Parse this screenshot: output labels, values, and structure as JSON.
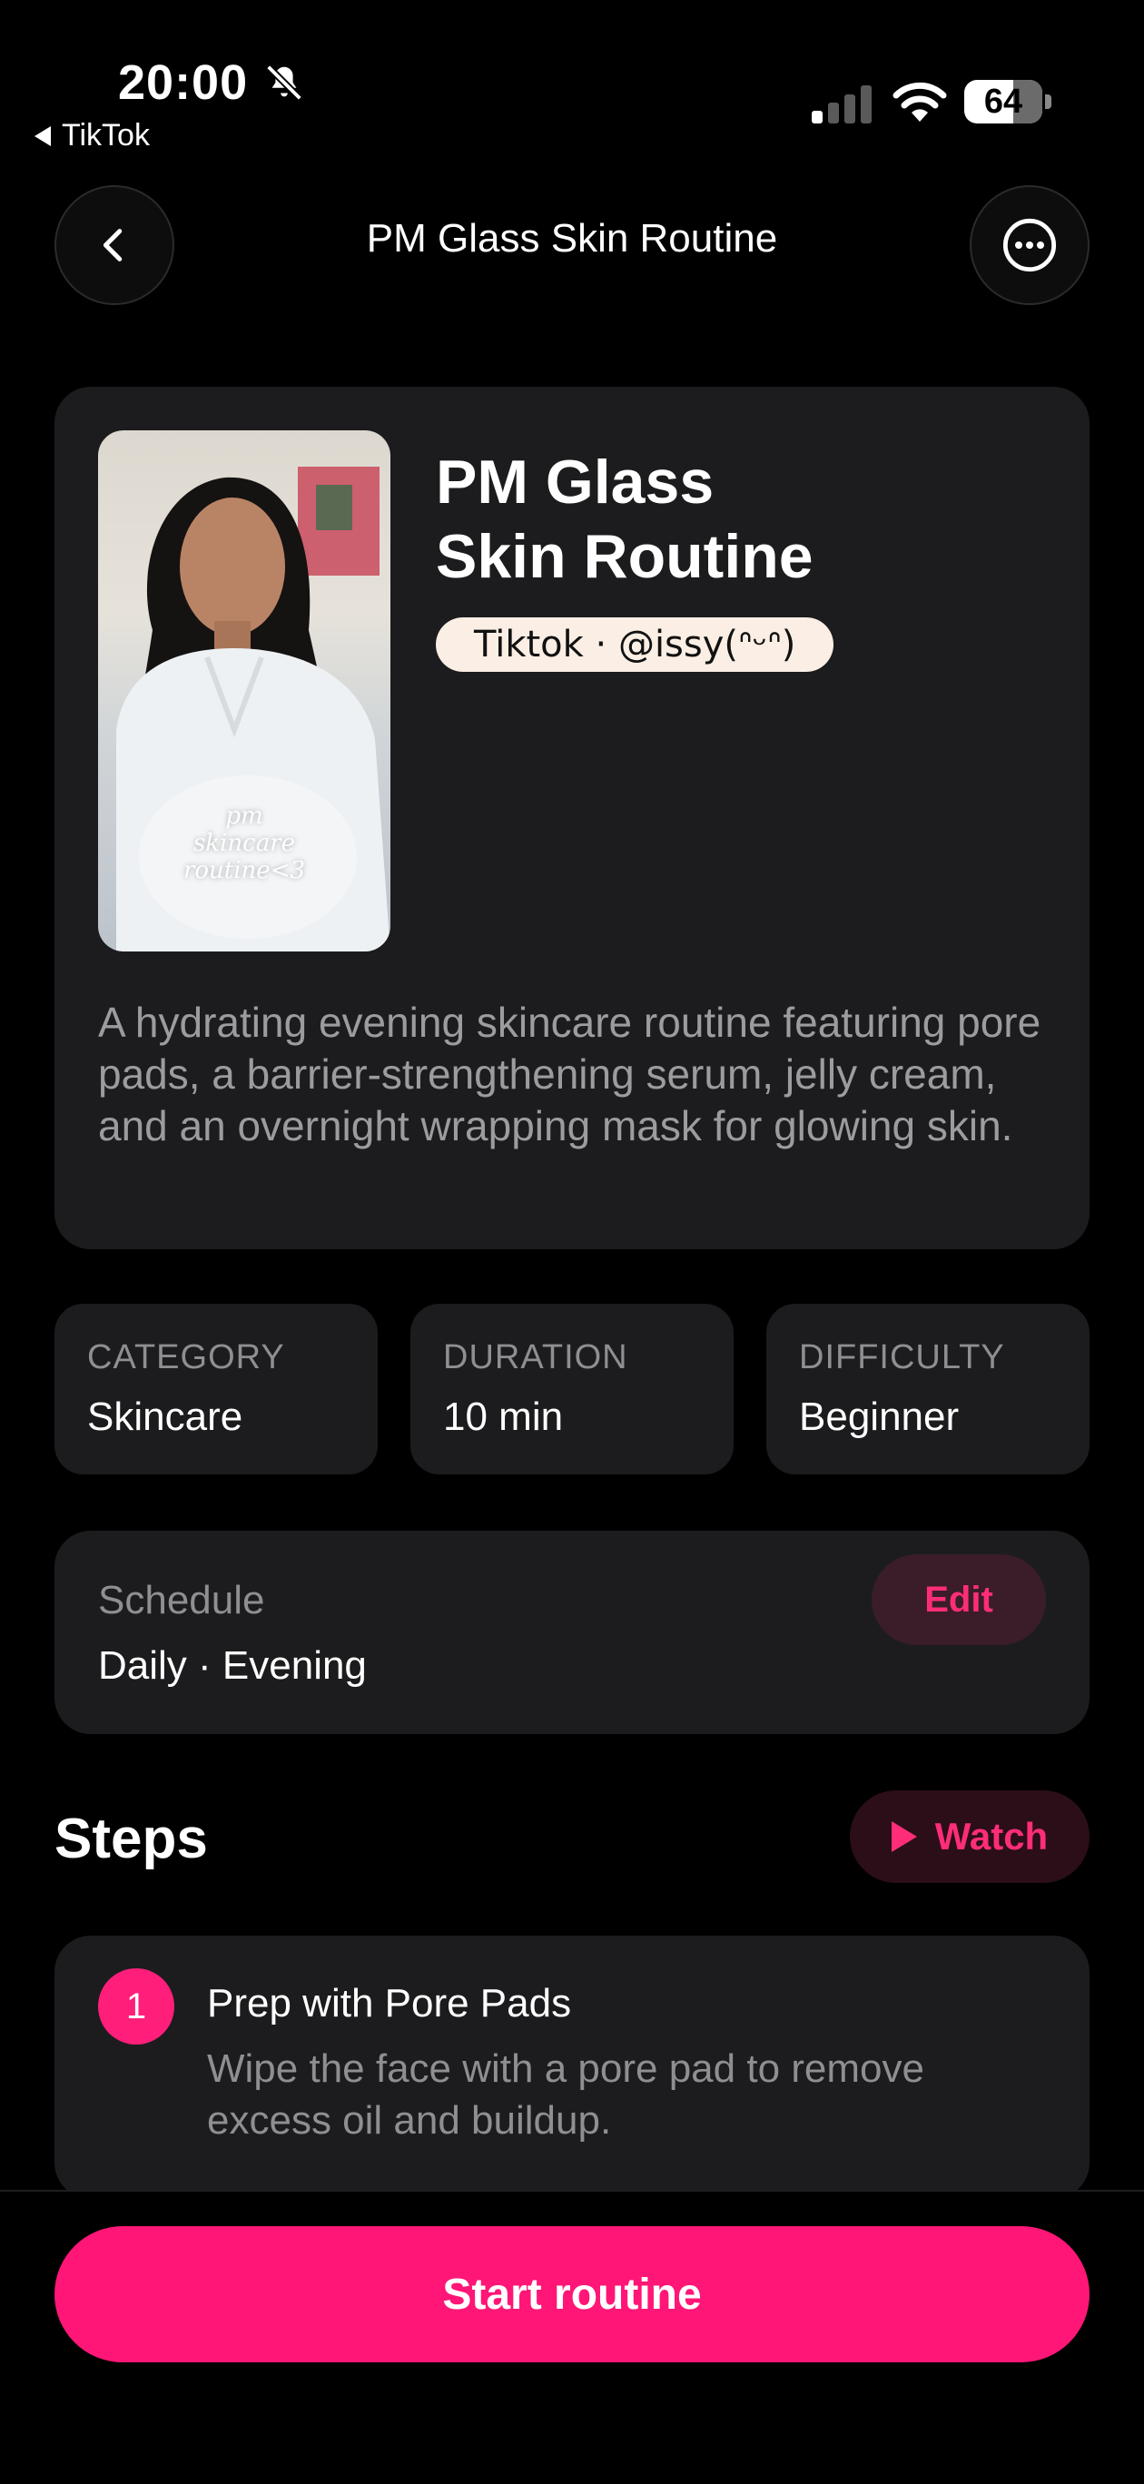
{
  "status_bar": {
    "time": "20:00",
    "back_app": "TikTok",
    "battery": "64",
    "icons": [
      "bell-slash-icon",
      "cellular-signal-icon",
      "wifi-icon",
      "battery-icon"
    ]
  },
  "nav": {
    "title": "PM Glass Skin Routine",
    "back_icon": "chevron-left-icon",
    "more_icon": "ellipsis-circle-icon"
  },
  "hero": {
    "title_line1": "PM Glass",
    "title_line2": "Skin Routine",
    "source": "Tiktok · @issy(ᐢᵕᐢ)",
    "thumbnail_caption_1": "pm",
    "thumbnail_caption_2": "skincare",
    "thumbnail_caption_3": "routine<3",
    "description": "A hydrating evening skincare routine featuring pore pads, a barrier-strengthening serum, jelly cream, and an overnight wrapping mask for glowing skin."
  },
  "stats": [
    {
      "label": "CATEGORY",
      "value": "Skincare"
    },
    {
      "label": "DURATION",
      "value": "10 min"
    },
    {
      "label": "DIFFICULTY",
      "value": "Beginner"
    }
  ],
  "schedule": {
    "label": "Schedule",
    "value": "Daily · Evening",
    "edit_label": "Edit"
  },
  "steps": {
    "title": "Steps",
    "watch_label": "Watch",
    "items": [
      {
        "number": "1",
        "title": "Prep with Pore Pads",
        "description": "Wipe the face with a pore pad to remove excess oil and buildup."
      }
    ]
  },
  "footer": {
    "start_label": "Start routine"
  },
  "colors": {
    "accent": "#ff1677",
    "card": "#1c1c1e",
    "muted_text": "#8e8e93",
    "background": "#000000"
  }
}
